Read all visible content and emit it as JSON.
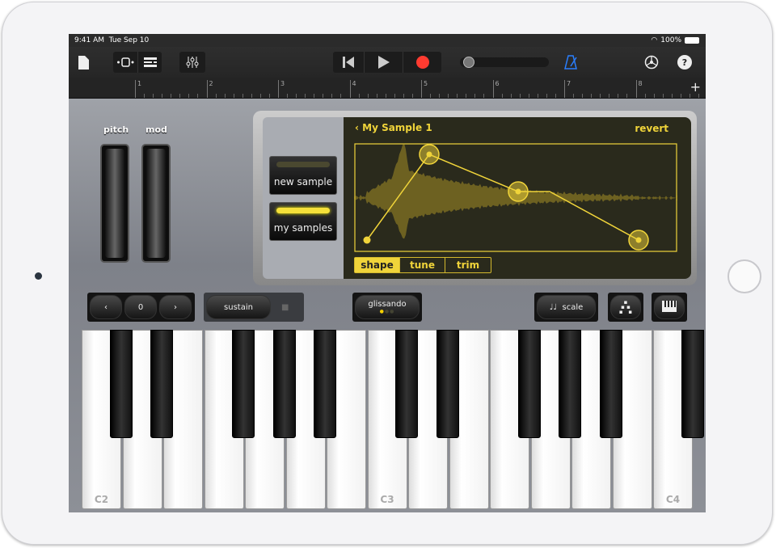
{
  "status": {
    "time": "9:41 AM",
    "date": "Tue Sep 10",
    "battery": "100%"
  },
  "toolbar": {
    "icons": [
      "document-icon",
      "track-view-icon",
      "tracks-list-icon",
      "mixer-icon",
      "go-to-start-icon",
      "play-icon",
      "record-icon",
      "metronome-icon",
      "settings-icon",
      "help-icon"
    ],
    "record_color": "#ff3b30",
    "metronome_color": "#2a7fff",
    "help_label": "?"
  },
  "ruler": {
    "bars": [
      "1",
      "2",
      "3",
      "4",
      "5",
      "6",
      "7",
      "8"
    ],
    "add_label": "+"
  },
  "wheels": {
    "pitch": "pitch",
    "mod": "mod"
  },
  "sampler": {
    "new_sample": "new sample",
    "my_samples": "my samples",
    "title": "My Sample 1",
    "revert": "revert",
    "tabs": [
      "shape",
      "tune",
      "trim"
    ],
    "selected_tab": "shape",
    "accent": "#f0d43a"
  },
  "controls": {
    "octave_value": "0",
    "sustain": "sustain",
    "glissando": "glissando",
    "scale": "scale"
  },
  "keyboard": {
    "labels": {
      "0": "C2",
      "7": "C3",
      "14": "C4"
    }
  }
}
